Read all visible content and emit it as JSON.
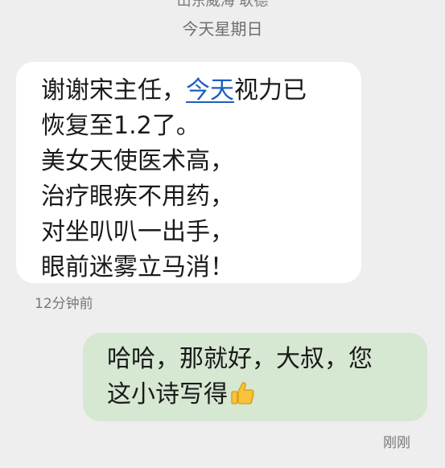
{
  "header": {
    "contact_partial": "山东威海 耿德",
    "date_separator": "今天星期日"
  },
  "messages": [
    {
      "direction": "incoming",
      "line1_before_link": "谢谢宋主任，",
      "line1_link": "今天",
      "line1_after_link": "视力已",
      "lines": [
        "恢复至1.2了。",
        "美女天使医术高，",
        "治疗眼疾不用药，",
        "对坐叭叭一出手，",
        "眼前迷雾立马消！"
      ],
      "time": "12分钟前"
    },
    {
      "direction": "outgoing",
      "line1": "哈哈，那就好，大叔，您",
      "line2": "这小诗写得",
      "emoji": "thumbs-up-icon",
      "time": "刚刚"
    }
  ],
  "colors": {
    "background": "#eeeeee",
    "incoming_bubble": "#ffffff",
    "outgoing_bubble": "#d6e7d2",
    "link": "#1f5fbf"
  }
}
